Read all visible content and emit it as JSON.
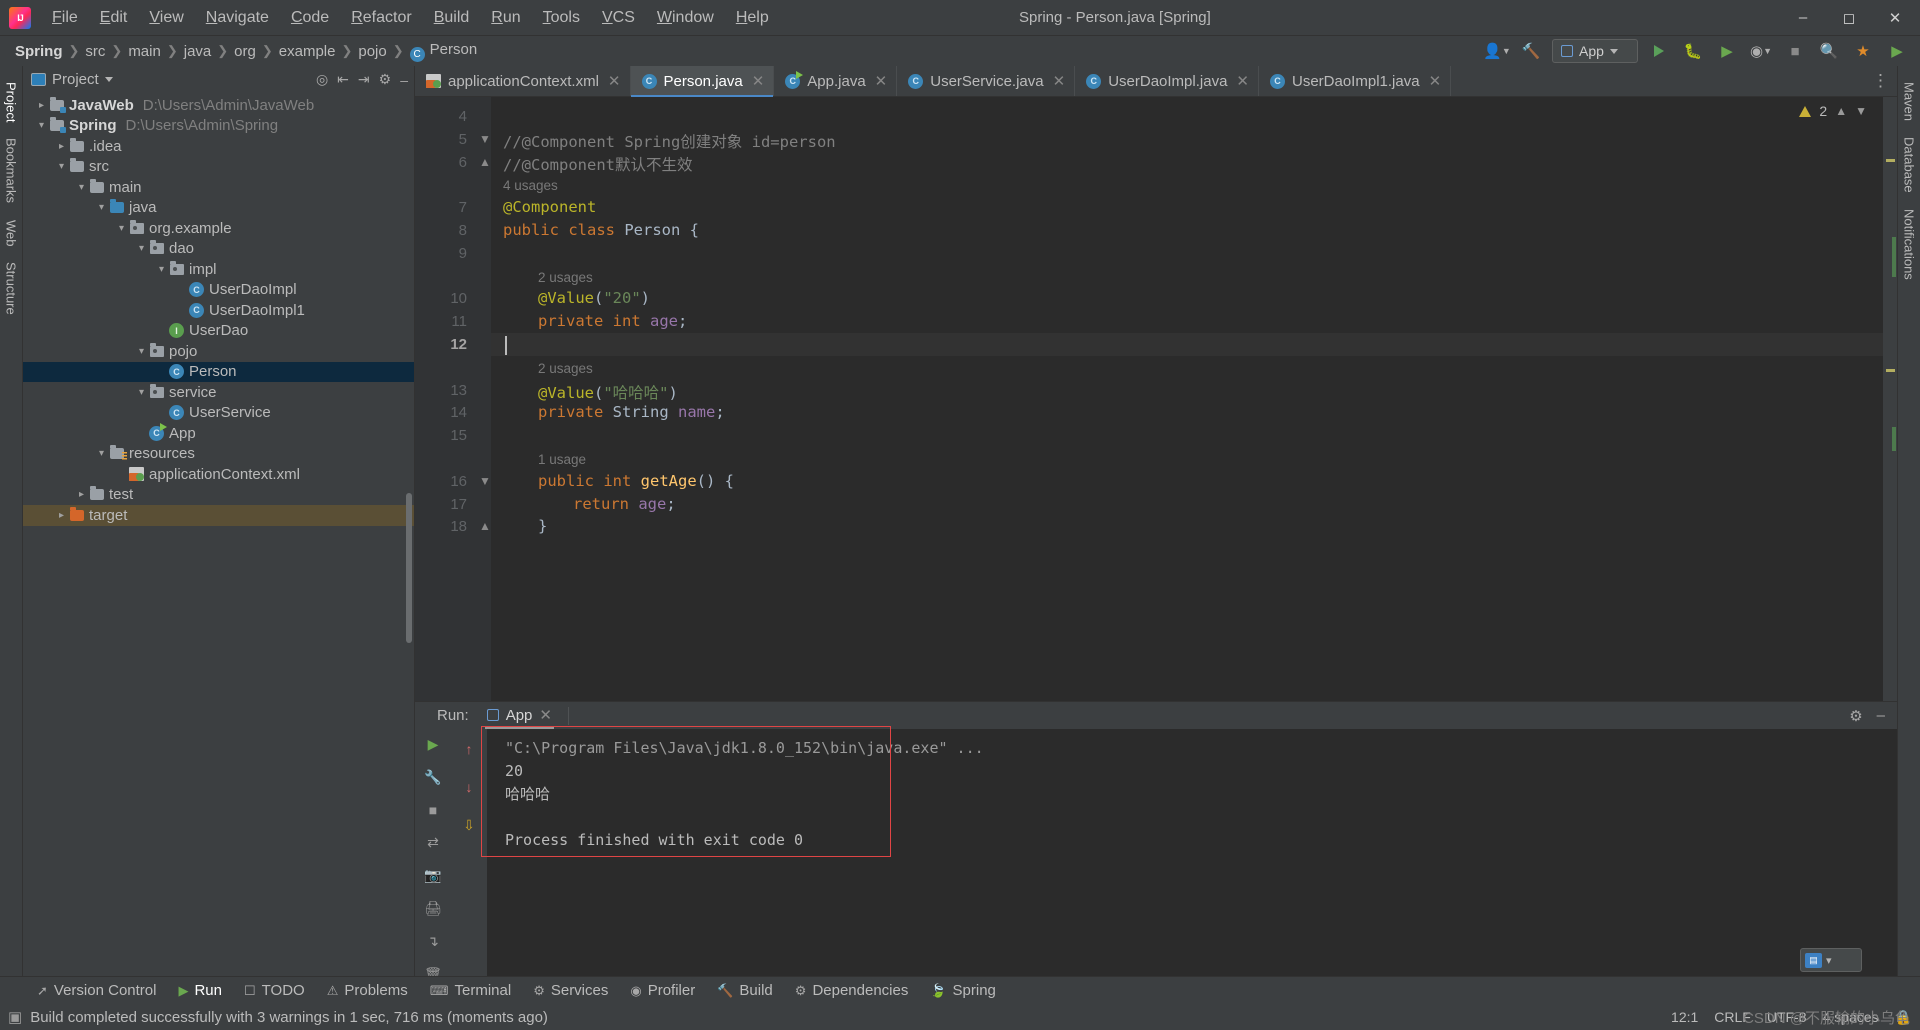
{
  "window": {
    "title": "Spring - Person.java [Spring]",
    "logo_icon": "intellij-idea-logo",
    "minimize_icon": "minimize-icon",
    "maximize_icon": "maximize-icon",
    "close_icon": "close-icon"
  },
  "menu": [
    "File",
    "Edit",
    "View",
    "Navigate",
    "Code",
    "Refactor",
    "Build",
    "Run",
    "Tools",
    "VCS",
    "Window",
    "Help"
  ],
  "breadcrumb": [
    {
      "label": "Spring",
      "bold": true
    },
    {
      "label": "src",
      "bold": false
    },
    {
      "label": "main",
      "bold": false
    },
    {
      "label": "java",
      "bold": false
    },
    {
      "label": "org",
      "bold": false
    },
    {
      "label": "example",
      "bold": false
    },
    {
      "label": "pojo",
      "bold": false
    },
    {
      "label": "Person",
      "bold": false,
      "icon": "class-icon"
    }
  ],
  "nav_right": {
    "account_icon": "account-icon",
    "hammer_icon": "build-hammer-icon",
    "run_config": "App",
    "run_icon": "run-icon",
    "debug_icon": "debug-icon",
    "run_coverage_icon": "run-with-coverage-icon",
    "profiler_icon": "profiler-icon",
    "stop_icon": "stop-icon",
    "search_icon": "search-icon",
    "updates_icon": "updates-icon",
    "more_icon": "more-icon"
  },
  "left_strip": [
    {
      "label": "Project",
      "active": true
    },
    {
      "label": "Bookmarks",
      "active": false
    },
    {
      "label": "Web",
      "active": false
    },
    {
      "label": "Structure",
      "active": false
    }
  ],
  "right_strip": [
    {
      "label": "Maven",
      "active": false
    },
    {
      "label": "Database",
      "active": false
    },
    {
      "label": "Notifications",
      "active": false
    }
  ],
  "project_panel": {
    "title": "Project",
    "dropdown_icon": "chevron-down-icon",
    "tools": [
      "select-opened-file-icon",
      "expand-all-icon",
      "collapse-all-icon",
      "settings-gear-icon",
      "hide-icon"
    ],
    "tree": [
      {
        "depth": 0,
        "arrow": "collapsed",
        "icon": "module-folder",
        "label": "JavaWeb",
        "bold": true,
        "path": "D:\\Users\\Admin\\JavaWeb"
      },
      {
        "depth": 0,
        "arrow": "expanded",
        "icon": "module-folder",
        "label": "Spring",
        "bold": true,
        "path": "D:\\Users\\Admin\\Spring"
      },
      {
        "depth": 1,
        "arrow": "collapsed",
        "icon": "folder",
        "label": ".idea"
      },
      {
        "depth": 1,
        "arrow": "expanded",
        "icon": "folder",
        "label": "src"
      },
      {
        "depth": 2,
        "arrow": "expanded",
        "icon": "folder",
        "label": "main"
      },
      {
        "depth": 3,
        "arrow": "expanded",
        "icon": "source-folder",
        "label": "java"
      },
      {
        "depth": 4,
        "arrow": "expanded",
        "icon": "package",
        "label": "org.example"
      },
      {
        "depth": 5,
        "arrow": "expanded",
        "icon": "package",
        "label": "dao"
      },
      {
        "depth": 6,
        "arrow": "expanded",
        "icon": "package",
        "label": "impl"
      },
      {
        "depth": 7,
        "arrow": "none",
        "icon": "class",
        "label": "UserDaoImpl"
      },
      {
        "depth": 7,
        "arrow": "none",
        "icon": "class",
        "label": "UserDaoImpl1"
      },
      {
        "depth": 6,
        "arrow": "none",
        "icon": "interface",
        "label": "UserDao"
      },
      {
        "depth": 5,
        "arrow": "expanded",
        "icon": "package",
        "label": "pojo"
      },
      {
        "depth": 6,
        "arrow": "none",
        "icon": "class",
        "label": "Person",
        "selected": true
      },
      {
        "depth": 5,
        "arrow": "expanded",
        "icon": "package",
        "label": "service"
      },
      {
        "depth": 6,
        "arrow": "none",
        "icon": "class",
        "label": "UserService"
      },
      {
        "depth": 5,
        "arrow": "none",
        "icon": "runnable-class",
        "label": "App"
      },
      {
        "depth": 3,
        "arrow": "expanded",
        "icon": "resources-folder",
        "label": "resources"
      },
      {
        "depth": 4,
        "arrow": "none",
        "icon": "spring-xml",
        "label": "applicationContext.xml"
      },
      {
        "depth": 2,
        "arrow": "collapsed",
        "icon": "folder",
        "label": "test"
      },
      {
        "depth": 1,
        "arrow": "collapsed",
        "icon": "excluded-folder",
        "label": "target",
        "highlight": true
      }
    ]
  },
  "editor": {
    "tabs": [
      {
        "label": "applicationContext.xml",
        "icon": "spring-xml-icon",
        "active": false
      },
      {
        "label": "Person.java",
        "icon": "class-icon",
        "active": true
      },
      {
        "label": "App.java",
        "icon": "runnable-class-icon",
        "active": false
      },
      {
        "label": "UserService.java",
        "icon": "class-icon",
        "active": false
      },
      {
        "label": "UserDaoImpl.java",
        "icon": "class-icon",
        "active": false
      },
      {
        "label": "UserDaoImpl1.java",
        "icon": "class-icon",
        "active": false
      }
    ],
    "more_tabs_icon": "vertical-dots-icon",
    "inspection": {
      "warning_icon": "warning-triangle-icon",
      "warning_count": "2",
      "up_icon": "chevron-up-icon",
      "down_icon": "chevron-down-icon"
    },
    "lines": [
      {
        "num": "4",
        "indent": 0,
        "tokens": []
      },
      {
        "num": "5",
        "indent": 0,
        "fold": "fold-start",
        "tokens": [
          {
            "t": "//@Component Spring创建对象 id=person",
            "c": "cm"
          }
        ]
      },
      {
        "num": "6",
        "indent": 0,
        "fold": "fold-end",
        "tokens": [
          {
            "t": "//@Component默认不生效",
            "c": "cm"
          }
        ]
      },
      {
        "num": "",
        "indent": 0,
        "hint": "4 usages"
      },
      {
        "num": "7",
        "indent": 0,
        "tokens": [
          {
            "t": "@Component",
            "c": "ann"
          }
        ]
      },
      {
        "num": "8",
        "indent": 0,
        "tokens": [
          {
            "t": "public ",
            "c": "kw"
          },
          {
            "t": "class ",
            "c": "kw"
          },
          {
            "t": "Person ",
            "c": "typ"
          },
          {
            "t": "{",
            "c": "pl"
          }
        ]
      },
      {
        "num": "9",
        "indent": 0,
        "tokens": []
      },
      {
        "num": "",
        "indent": 1,
        "hint": "2 usages"
      },
      {
        "num": "10",
        "indent": 1,
        "tokens": [
          {
            "t": "@Value",
            "c": "ann"
          },
          {
            "t": "(",
            "c": "pl"
          },
          {
            "t": "\"20\"",
            "c": "str"
          },
          {
            "t": ")",
            "c": "pl"
          }
        ]
      },
      {
        "num": "11",
        "indent": 1,
        "tokens": [
          {
            "t": "private ",
            "c": "kw"
          },
          {
            "t": "int ",
            "c": "kw"
          },
          {
            "t": "age",
            "c": "fld"
          },
          {
            "t": ";",
            "c": "pl"
          }
        ]
      },
      {
        "num": "12",
        "indent": 1,
        "tokens": [],
        "current": true
      },
      {
        "num": "",
        "indent": 1,
        "hint": "2 usages"
      },
      {
        "num": "13",
        "indent": 1,
        "tokens": [
          {
            "t": "@Value",
            "c": "ann"
          },
          {
            "t": "(",
            "c": "pl"
          },
          {
            "t": "\"哈哈哈\"",
            "c": "str"
          },
          {
            "t": ")",
            "c": "pl"
          }
        ]
      },
      {
        "num": "14",
        "indent": 1,
        "tokens": [
          {
            "t": "private ",
            "c": "kw"
          },
          {
            "t": "String ",
            "c": "typ"
          },
          {
            "t": "name",
            "c": "fld"
          },
          {
            "t": ";",
            "c": "pl"
          }
        ]
      },
      {
        "num": "15",
        "indent": 1,
        "tokens": []
      },
      {
        "num": "",
        "indent": 1,
        "hint": "1 usage"
      },
      {
        "num": "16",
        "indent": 1,
        "fold": "fold-start",
        "tokens": [
          {
            "t": "public ",
            "c": "kw"
          },
          {
            "t": "int ",
            "c": "kw"
          },
          {
            "t": "getAge",
            "c": "mth"
          },
          {
            "t": "() {",
            "c": "pl"
          }
        ]
      },
      {
        "num": "17",
        "indent": 2,
        "tokens": [
          {
            "t": "return ",
            "c": "kw"
          },
          {
            "t": "age",
            "c": "fld"
          },
          {
            "t": ";",
            "c": "pl"
          }
        ]
      },
      {
        "num": "18",
        "indent": 1,
        "fold": "fold-end",
        "tokens": [
          {
            "t": "}",
            "c": "pl"
          }
        ]
      }
    ]
  },
  "run_panel": {
    "label": "Run:",
    "tab_label": "App",
    "tab_icon": "run-configuration-icon",
    "close_icon": "close-icon",
    "settings_icon": "settings-gear-icon",
    "hide_icon": "hide-icon",
    "side_icons": [
      "rerun-icon",
      "wrench-icon",
      "stop-icon",
      "rerun-failed-icon",
      "camera-icon",
      "scroll-to-end-icon",
      "print-icon",
      "soft-wrap-icon",
      "trash-icon"
    ],
    "console": [
      {
        "text": "\"C:\\Program Files\\Java\\jdk1.8.0_152\\bin\\java.exe\" ...",
        "style": "cmd"
      },
      {
        "text": "20",
        "style": "out"
      },
      {
        "text": "哈哈哈",
        "style": "out"
      },
      {
        "text": "",
        "style": "out"
      },
      {
        "text": "Process finished with exit code 0",
        "style": "out"
      }
    ]
  },
  "bottom_bar": [
    {
      "label": "Version Control",
      "icon": "version-control-icon",
      "active": false
    },
    {
      "label": "Run",
      "icon": "run-icon",
      "active": true
    },
    {
      "label": "TODO",
      "icon": "todo-icon",
      "active": false
    },
    {
      "label": "Problems",
      "icon": "problems-icon",
      "active": false
    },
    {
      "label": "Terminal",
      "icon": "terminal-icon",
      "active": false
    },
    {
      "label": "Services",
      "icon": "services-icon",
      "active": false
    },
    {
      "label": "Profiler",
      "icon": "profiler-icon",
      "active": false
    },
    {
      "label": "Build",
      "icon": "build-hammer-icon",
      "active": false
    },
    {
      "label": "Dependencies",
      "icon": "dependencies-icon",
      "active": false
    },
    {
      "label": "Spring",
      "icon": "spring-leaf-icon",
      "active": false
    }
  ],
  "status_bar": {
    "icon": "build-status-icon",
    "message": "Build completed successfully with 3 warnings in 1 sec, 716 ms (moments ago)",
    "caret_position": "12:1",
    "line_separator": "CRLF",
    "encoding": "UTF-8",
    "indent": "4 spaces",
    "lock_icon": "lock-icon",
    "watermark": "CSDN @不服输的小乌龟"
  },
  "ime": {
    "label_icon": "ime-keyboard-icon",
    "chevron_icon": "chevron-up-down-icon"
  }
}
